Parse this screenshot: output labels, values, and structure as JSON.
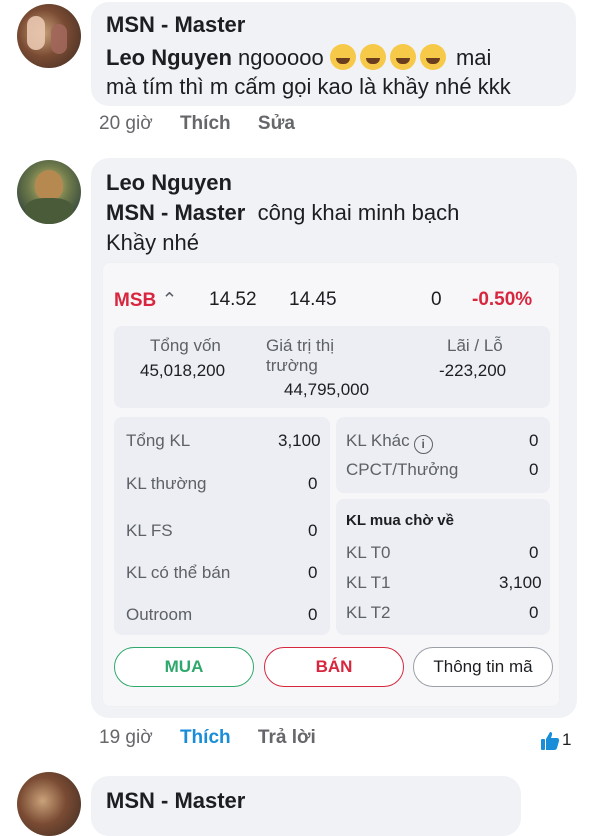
{
  "comment1": {
    "author": "MSN - Master",
    "mention": "Leo Nguyen",
    "text_line1": "ngooooo",
    "text_line1_tail": "mai",
    "text_line2": "mà tím thì m cấm gọi kao là khầy nhé kkk",
    "emoji_icon": "laughing-crying-emoji",
    "time": "20 giờ",
    "like": "Thích",
    "edit": "Sửa"
  },
  "comment2": {
    "author": "Leo Nguyen",
    "mention": "MSN - Master",
    "text_line1": "công khai minh bạch",
    "text_line2": "Khầy nhé",
    "time": "19 giờ",
    "like": "Thích",
    "reply": "Trả lời",
    "reaction_count": "1",
    "stock": {
      "symbol": "MSB",
      "price1": "14.52",
      "price2": "14.45",
      "qty": "0",
      "change": "-0.50%",
      "capital_label": "Tổng vốn",
      "capital_value": "45,018,200",
      "market_label_1": "Giá trị thị",
      "market_label_2": "trường",
      "market_value": "44,795,000",
      "pl_label": "Lãi / Lỗ",
      "pl_value": "-223,200",
      "left_rows": [
        {
          "label": "Tổng KL",
          "value": "3,100"
        },
        {
          "label": "KL thường",
          "value": "0"
        },
        {
          "label": "KL FS",
          "value": "0"
        },
        {
          "label": "KL có thể bán",
          "value": "0"
        },
        {
          "label": "Outroom",
          "value": "0"
        }
      ],
      "right_top": [
        {
          "label": "KL Khác",
          "value": "0"
        },
        {
          "label": "CPCT/Thưởng",
          "value": "0"
        }
      ],
      "pending_title": "KL mua chờ về",
      "pending_rows": [
        {
          "label": "KL T0",
          "value": "0"
        },
        {
          "label": "KL T1",
          "value": "3,100"
        },
        {
          "label": "KL T2",
          "value": "0"
        }
      ],
      "buy": "MUA",
      "sell": "BÁN",
      "info": "Thông tin mã"
    }
  },
  "comment3": {
    "author": "MSN - Master"
  },
  "colors": {
    "accent_blue": "#1a8dd8",
    "red": "#d7263d",
    "green": "#2ea86b",
    "bubble": "#f0f2f5"
  }
}
